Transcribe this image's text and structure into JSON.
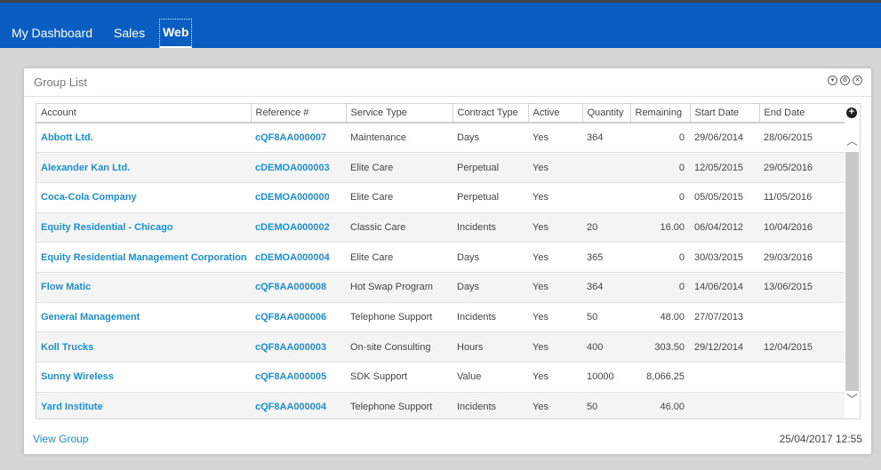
{
  "nav": {
    "items": [
      "My Dashboard",
      "Sales",
      "Web"
    ],
    "active": 2
  },
  "panel": {
    "title": "Group List",
    "icons": [
      "dropdown-icon",
      "gear-icon",
      "close-icon"
    ]
  },
  "table": {
    "columns": [
      "Account",
      "Reference #",
      "Service Type",
      "Contract Type",
      "Active",
      "Quantity",
      "Remaining",
      "Start Date",
      "End Date"
    ],
    "rows": [
      [
        "Abbott Ltd.",
        "cQF8AA000007",
        "Maintenance",
        "Days",
        "Yes",
        "364",
        "0",
        "29/06/2014",
        "28/06/2015"
      ],
      [
        "Alexander Kan Ltd.",
        "cDEMOA000003",
        "Elite Care",
        "Perpetual",
        "Yes",
        "",
        "0",
        "12/05/2015",
        "29/05/2016"
      ],
      [
        "Coca-Cola Company",
        "cDEMOA000000",
        "Elite Care",
        "Perpetual",
        "Yes",
        "",
        "0",
        "05/05/2015",
        "11/05/2016"
      ],
      [
        "Equity Residential - Chicago",
        "cDEMOA000002",
        "Classic Care",
        "Incidents",
        "Yes",
        "20",
        "16.00",
        "06/04/2012",
        "10/04/2016"
      ],
      [
        "Equity Residential Management Corporation",
        "cDEMOA000004",
        "Elite Care",
        "Days",
        "Yes",
        "365",
        "0",
        "30/03/2015",
        "29/03/2016"
      ],
      [
        "Flow Matic",
        "cQF8AA000008",
        "Hot Swap Program",
        "Days",
        "Yes",
        "364",
        "0",
        "14/06/2014",
        "13/06/2015"
      ],
      [
        "General Management",
        "cQF8AA000006",
        "Telephone Support",
        "Incidents",
        "Yes",
        "50",
        "48.00",
        "27/07/2013",
        ""
      ],
      [
        "Koll Trucks",
        "cQF8AA000003",
        "On-site Consulting",
        "Hours",
        "Yes",
        "400",
        "303.50",
        "29/12/2014",
        "12/04/2015"
      ],
      [
        "Sunny Wireless",
        "cQF8AA000005",
        "SDK Support",
        "Value",
        "Yes",
        "10000",
        "8,066.25",
        "",
        ""
      ],
      [
        "Yard Institute",
        "cQF8AA000004",
        "Telephone Support",
        "Incidents",
        "Yes",
        "50",
        "46.00",
        "",
        ""
      ]
    ]
  },
  "footer": {
    "link": "View Group",
    "timestamp": "25/04/2017 12:55"
  },
  "colors": {
    "topbar": "#0a5ec2",
    "link": "#1a8fd6"
  }
}
